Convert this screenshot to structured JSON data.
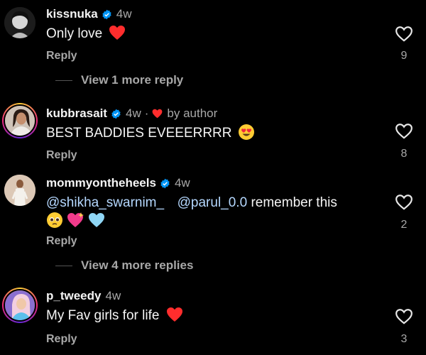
{
  "comments": [
    {
      "username": "kissnuka",
      "time": "4w",
      "text": "Only love",
      "reply": "Reply",
      "likes": "9",
      "view_more": "View 1 more reply"
    },
    {
      "username": "kubbrasait",
      "time": "4w",
      "liked_by": "by author",
      "text": "BEST BADDIES EVEEERRRR",
      "reply": "Reply",
      "likes": "8"
    },
    {
      "username": "mommyontheheels",
      "time": "4w",
      "mention1": "@shikha_swarnim_",
      "mention2": "@parul_0.0",
      "text_after": "remember this",
      "reply": "Reply",
      "likes": "2",
      "view_more": "View 4 more replies"
    },
    {
      "username": "p_tweedy",
      "time": "4w",
      "text": "My Fav girls for life",
      "reply": "Reply",
      "likes": "3"
    }
  ],
  "icons": {
    "verified": "verified-badge-icon",
    "heart": "red-heart-emoji",
    "like": "heart-outline-icon"
  },
  "colors": {
    "background": "#000000",
    "verified_blue": "#0095f6",
    "secondary_text": "#a8a8a8",
    "heart_red": "#ff2d2d"
  }
}
